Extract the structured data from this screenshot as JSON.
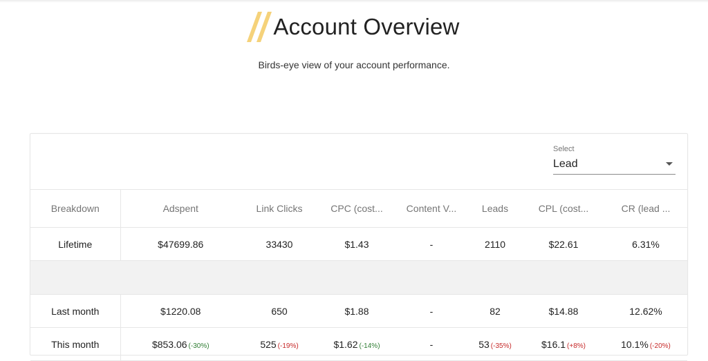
{
  "header": {
    "title": "Account Overview",
    "subtitle": "Birds-eye view of your account performance."
  },
  "select": {
    "label": "Select",
    "value": "Lead"
  },
  "table": {
    "columns": [
      "Breakdown",
      "Adspent",
      "Link Clicks",
      "CPC (cost...",
      "Content V...",
      "Leads",
      "CPL (cost...",
      "CR (lead ..."
    ],
    "rows": {
      "lifetime": {
        "breakdown": "Lifetime",
        "adspent": "$47699.86",
        "link_clicks": "33430",
        "cpc": "$1.43",
        "content_views": "-",
        "leads": "2110",
        "cpl": "$22.61",
        "cr": "6.31%"
      },
      "last_month": {
        "breakdown": "Last month",
        "adspent": "$1220.08",
        "link_clicks": "650",
        "cpc": "$1.88",
        "content_views": "-",
        "leads": "82",
        "cpl": "$14.88",
        "cr": "12.62%"
      },
      "this_month": {
        "breakdown": "This month",
        "adspent": "$853.06",
        "adspent_delta": "(-30%)",
        "link_clicks": "525",
        "link_clicks_delta": "(-19%)",
        "cpc": "$1.62",
        "cpc_delta": "(-14%)",
        "content_views": "-",
        "leads": "53",
        "leads_delta": "(-35%)",
        "cpl": "$16.1",
        "cpl_delta": "(+8%)",
        "cr": "10.1%",
        "cr_delta": "(-20%)"
      }
    }
  },
  "colors": {
    "accent_slashes": "#f5d27a",
    "delta_good": "#2e7d32",
    "delta_bad": "#c62828"
  }
}
